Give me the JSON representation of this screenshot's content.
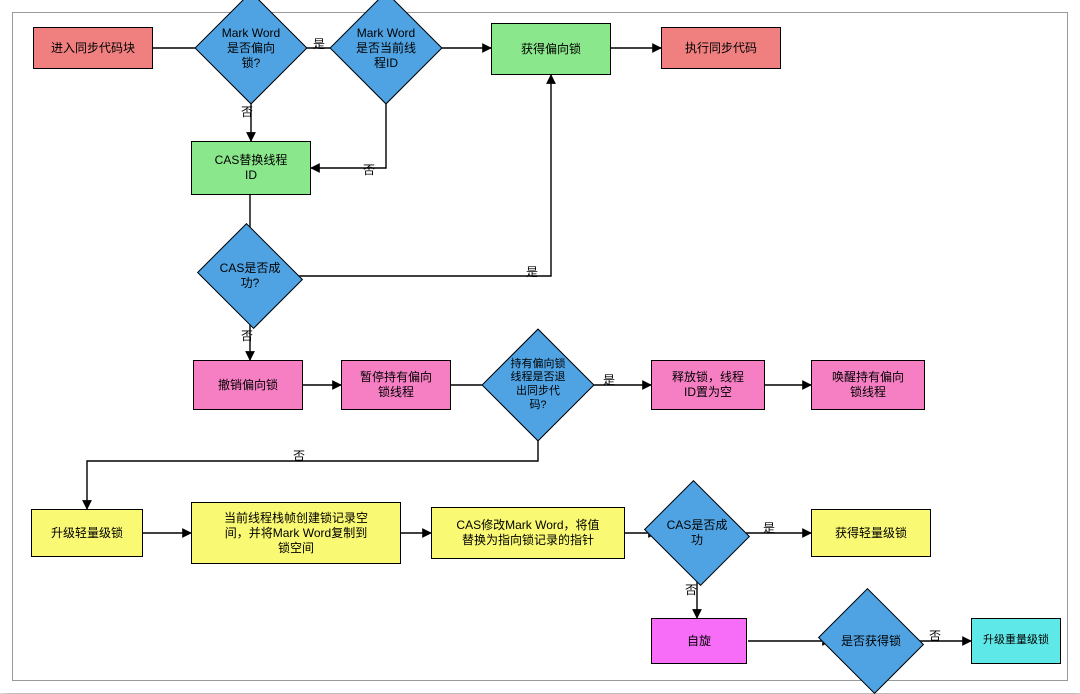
{
  "nodes": {
    "enter": {
      "label": "进入同步代码块"
    },
    "isBiased": {
      "label": "Mark Word\n是否偏向\n锁?"
    },
    "isCurThread": {
      "label": "Mark Word\n是否当前线\n程ID"
    },
    "acqBiased": {
      "label": "获得偏向锁"
    },
    "execSync": {
      "label": "执行同步代码"
    },
    "casReplace": {
      "label": "CAS替换线程\nID"
    },
    "casOk": {
      "label": "CAS是否成\n功?"
    },
    "revokeBiased": {
      "label": "撤销偏向锁"
    },
    "pauseBiased": {
      "label": "暂停持有偏向\n锁线程"
    },
    "exitedSync": {
      "label": "持有偏向锁\n线程是否退\n出同步代\n码?"
    },
    "releaseLock": {
      "label": "释放锁，线程\nID置为空"
    },
    "wakeBiased": {
      "label": "唤醒持有偏向\n锁线程"
    },
    "upgLight": {
      "label": "升级轻量级锁"
    },
    "stackRecord": {
      "label": "当前线程栈帧创建锁记录空\n间，并将Mark Word复制到\n锁空间"
    },
    "casModify": {
      "label": "CAS修改Mark Word，将值\n替换为指向锁记录的指针"
    },
    "casOk2": {
      "label": "CAS是否成\n功"
    },
    "acqLight": {
      "label": "获得轻量级锁"
    },
    "spin": {
      "label": "自旋"
    },
    "gotLock": {
      "label": "是否获得锁"
    },
    "upgHeavy": {
      "label": "升级重量级锁"
    }
  },
  "labels": {
    "yes": "是",
    "no": "否"
  }
}
